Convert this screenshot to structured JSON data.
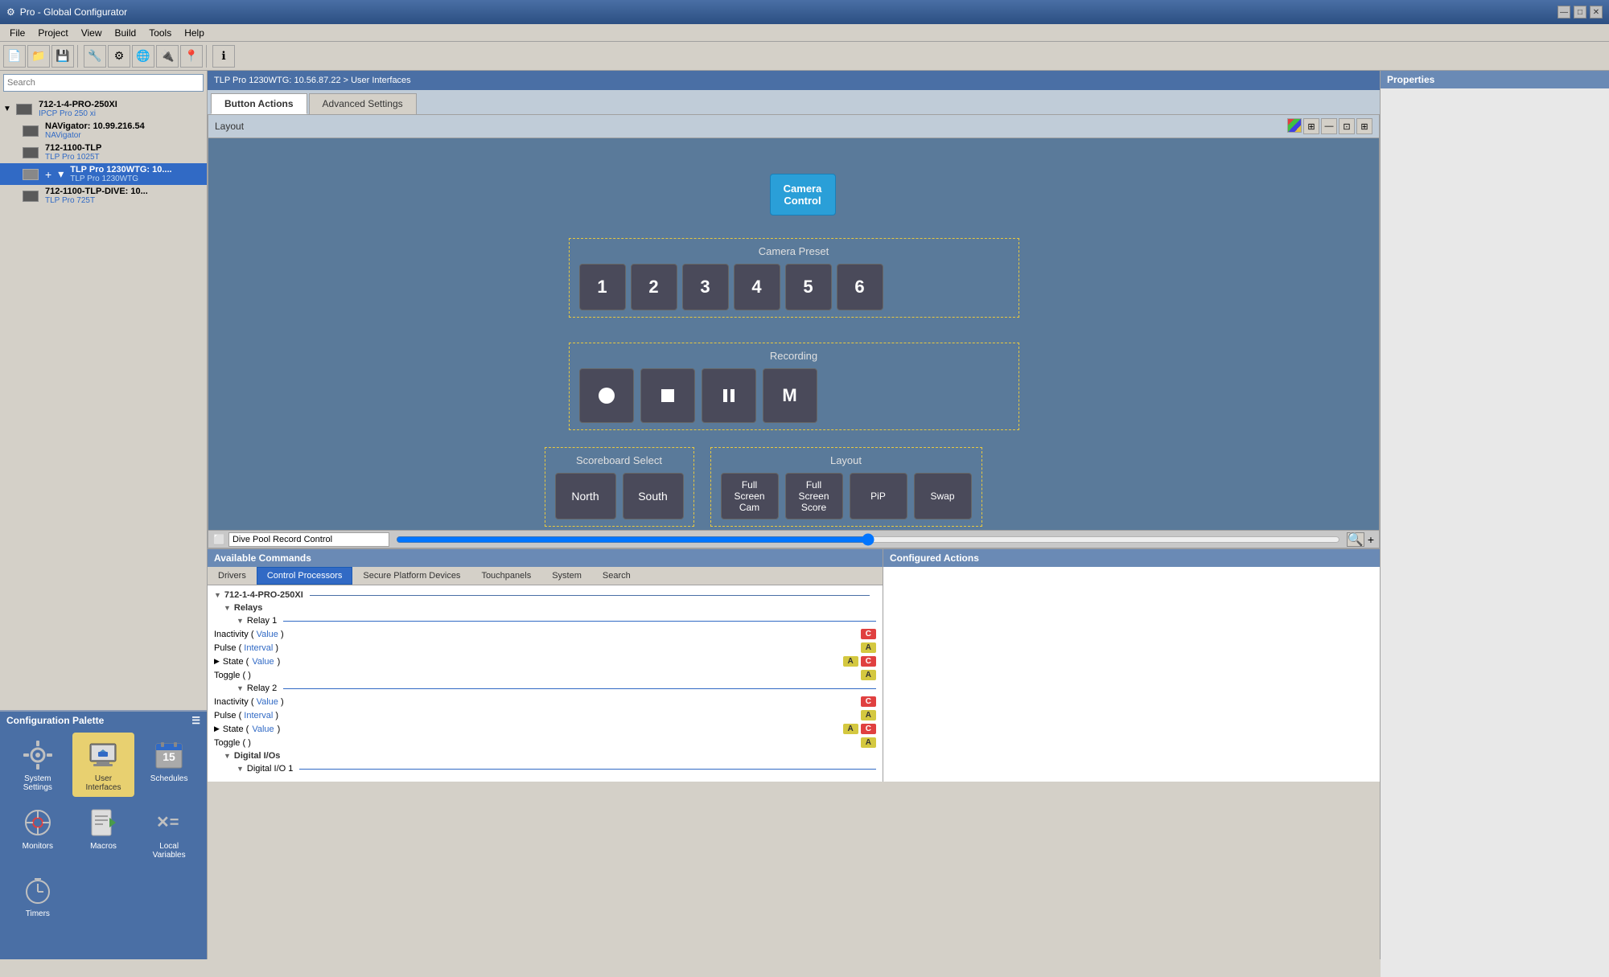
{
  "app": {
    "title": "Pro - Global Configurator",
    "icon": "⚙"
  },
  "titlebar": {
    "title": "Pro - Global Configurator",
    "minimize": "—",
    "maximize": "□",
    "close": "✕"
  },
  "menubar": {
    "items": [
      "File",
      "Project",
      "View",
      "Build",
      "Tools",
      "Help"
    ]
  },
  "breadcrumb": {
    "text": "TLP Pro 1230WTG: 10.56.87.22 > User Interfaces"
  },
  "search": {
    "placeholder": "Search"
  },
  "device_tree": {
    "items": [
      {
        "id": "dev1",
        "title": "712-1-4-PRO-250XI",
        "subtitle": "IPCP Pro 250 xi",
        "level": 0,
        "expanded": true
      },
      {
        "id": "dev2",
        "title": "NAVigator: 10.99.216.54",
        "subtitle": "NAVigator",
        "level": 1,
        "selected": false
      },
      {
        "id": "dev3",
        "title": "712-1100-TLP",
        "subtitle": "TLP Pro 1025T",
        "level": 1,
        "selected": false
      },
      {
        "id": "dev4",
        "title": "TLP Pro 1230WTG: 10....",
        "subtitle": "TLP Pro 1230WTG",
        "level": 1,
        "selected": true
      },
      {
        "id": "dev5",
        "title": "712-1100-TLP-DIVE: 10...",
        "subtitle": "TLP Pro 725T",
        "level": 1,
        "selected": false
      }
    ]
  },
  "config_palette": {
    "title": "Configuration Palette",
    "items": [
      {
        "id": "system_settings",
        "label": "System\nSettings",
        "icon": "⚙",
        "active": false
      },
      {
        "id": "user_interfaces",
        "label": "User\nInterfaces",
        "icon": "🖱",
        "active": true
      },
      {
        "id": "schedules",
        "label": "Schedules",
        "icon": "📅",
        "active": false
      },
      {
        "id": "monitors",
        "label": "Monitors",
        "icon": "👁",
        "active": false
      },
      {
        "id": "macros",
        "label": "Macros",
        "icon": "📄",
        "active": false
      },
      {
        "id": "local_variables",
        "label": "Local\nVariables",
        "icon": "✕=",
        "active": false
      },
      {
        "id": "timers",
        "label": "Timers",
        "icon": "⏱",
        "active": false
      }
    ]
  },
  "tabs": {
    "button_actions": "Button Actions",
    "advanced_settings": "Advanced Settings",
    "active": "button_actions"
  },
  "layout": {
    "title": "Layout",
    "cam_control": "Camera\nControl",
    "camera_preset": {
      "label": "Camera Preset",
      "buttons": [
        "1",
        "2",
        "3",
        "4",
        "5",
        "6"
      ]
    },
    "recording": {
      "label": "Recording",
      "buttons": [
        "●",
        "■",
        "⏸",
        "M"
      ]
    },
    "scoreboard": {
      "label": "Scoreboard Select",
      "buttons": [
        "North",
        "South"
      ]
    },
    "layout_section": {
      "label": "Layout",
      "buttons": [
        "Full\nScreen\nCam",
        "Full\nScreen\nScore",
        "PiP",
        "Swap"
      ]
    }
  },
  "canvas_scrollbar": {
    "field_value": "Dive Pool Record Control"
  },
  "available_commands": {
    "title": "Available Commands",
    "tabs": [
      "Drivers",
      "Control Processors",
      "Secure Platform Devices",
      "Touchpanels",
      "System",
      "Search"
    ],
    "active_tab": "Control Processors",
    "tree": {
      "device": "712-1-4-PRO-250XI",
      "groups": [
        {
          "name": "Relays",
          "items": [
            {
              "name": "Relay 1",
              "commands": [
                {
                  "label": "Inactivity",
                  "param": "Value",
                  "badges": [
                    "C"
                  ]
                },
                {
                  "label": "Pulse",
                  "param": "Interval",
                  "badges": [
                    "A"
                  ]
                },
                {
                  "label": "State",
                  "param": "Value",
                  "badges": [
                    "A",
                    "C"
                  ],
                  "has_arrow": true
                },
                {
                  "label": "Toggle",
                  "param": "",
                  "badges": [
                    "A"
                  ]
                }
              ]
            },
            {
              "name": "Relay 2",
              "commands": [
                {
                  "label": "Inactivity",
                  "param": "Value",
                  "badges": [
                    "C"
                  ]
                },
                {
                  "label": "Pulse",
                  "param": "Interval",
                  "badges": [
                    "A"
                  ]
                },
                {
                  "label": "State",
                  "param": "Value",
                  "badges": [
                    "A",
                    "C"
                  ],
                  "has_arrow": true
                },
                {
                  "label": "Toggle",
                  "param": "",
                  "badges": [
                    "A"
                  ]
                }
              ]
            }
          ]
        },
        {
          "name": "Digital I/Os",
          "items": [
            {
              "name": "Digital I/O 1",
              "commands": []
            }
          ]
        }
      ]
    }
  },
  "configured_actions": {
    "title": "Configured Actions"
  },
  "properties": {
    "title": "Properties"
  }
}
